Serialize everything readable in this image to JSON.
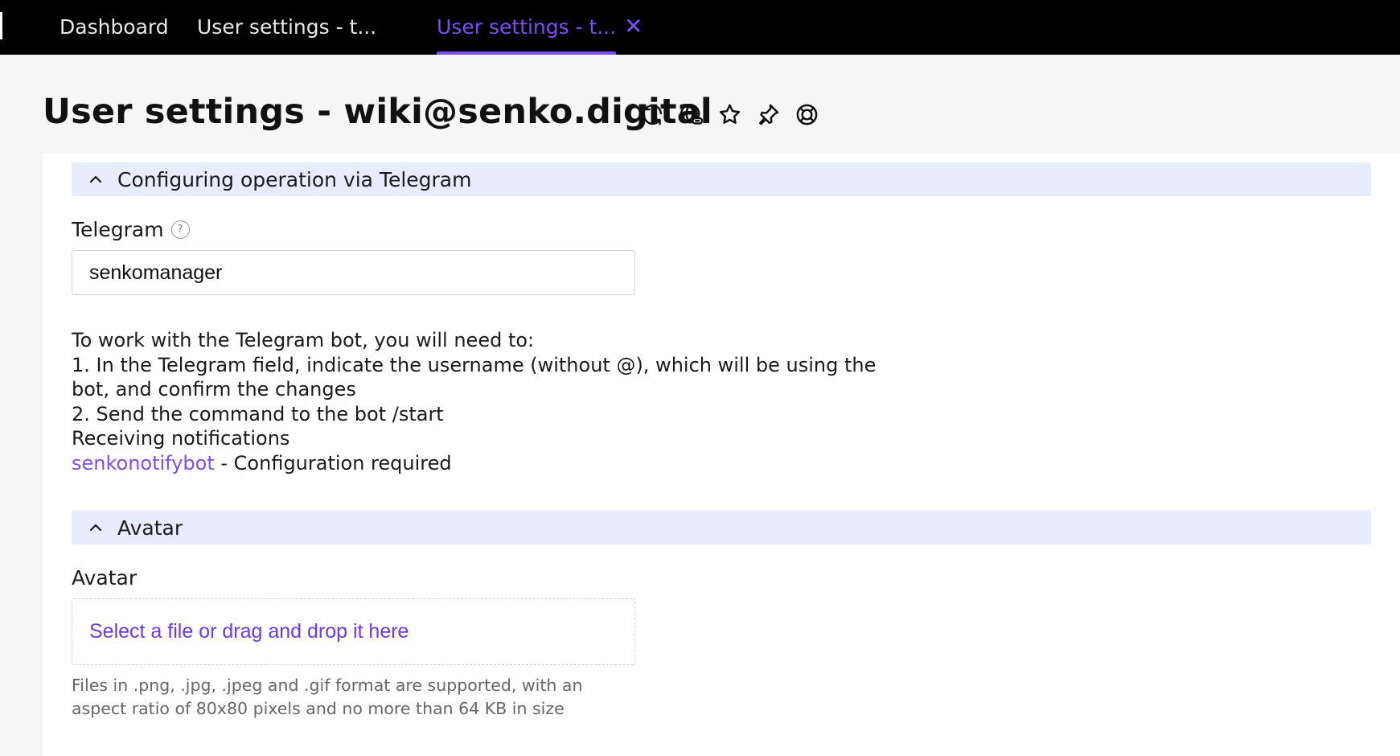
{
  "tabs": [
    {
      "label": "Dashboard"
    },
    {
      "label": "User settings - t..."
    },
    {
      "label": "User settings - t...",
      "active": true
    }
  ],
  "tab_close_glyph": "✕",
  "page": {
    "title": "User settings - wiki@senko.digital"
  },
  "title_icons": [
    "refresh-icon",
    "globe-link-icon",
    "star-icon",
    "pin-icon",
    "lifebuoy-icon"
  ],
  "telegram_section": {
    "header": "Configuring operation via Telegram",
    "field_label": "Telegram",
    "help_glyph": "?",
    "value": "senkomanager",
    "instructions": [
      "To work with the Telegram bot, you will need to:",
      "1. In the Telegram field, indicate the username (without @), which will be using the",
      "bot, and confirm the changes",
      "2. Send the command to the bot /start",
      "Receiving notifications"
    ],
    "bot_link": "senkonotifybot",
    "bot_status": " - Configuration required"
  },
  "avatar_section": {
    "header": "Avatar",
    "field_label": "Avatar",
    "dropzone_text": "Select a file or drag and drop it here",
    "hint": [
      "Files in .png, .jpg, .jpeg and .gif format are supported, with an",
      "aspect ratio of 80x80 pixels and no more than 64 KB in size"
    ]
  },
  "colors": {
    "accent": "#7b4df5",
    "section_bg": "#e7edfd",
    "topbar_bg": "#000000"
  }
}
